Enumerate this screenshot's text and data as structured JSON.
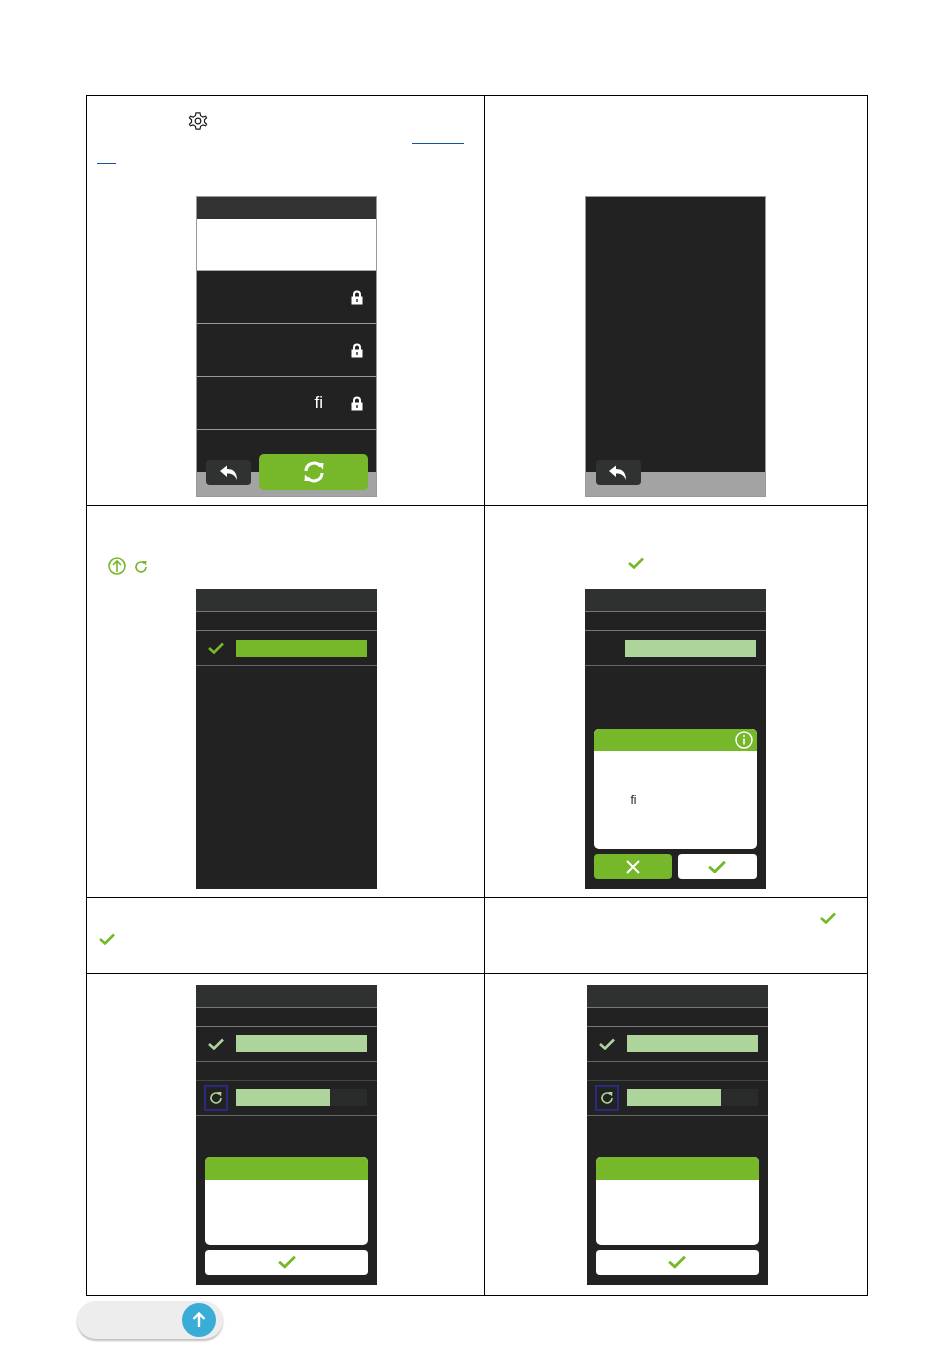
{
  "cells": [
    {
      "kind": "settings",
      "lock_rows": [
        {
          "label": ""
        },
        {
          "label": ""
        },
        {
          "label": "fi"
        }
      ]
    },
    {
      "kind": "blank"
    },
    {
      "kind": "progress",
      "bars": [
        {
          "level": 1,
          "done": true,
          "highlighted": true
        }
      ]
    },
    {
      "kind": "confirm",
      "bars": [
        {
          "level": 1,
          "done": false,
          "highlighted": false
        }
      ],
      "dialog_text": "fi"
    },
    {
      "kind": "note_left"
    },
    {
      "kind": "note_right"
    },
    {
      "kind": "result",
      "bars": [
        {
          "level": 1,
          "done": true,
          "highlighted": false
        },
        {
          "level": 0.72,
          "done": false,
          "highlighted": false
        }
      ]
    },
    {
      "kind": "result",
      "bars": [
        {
          "level": 1,
          "done": true,
          "highlighted": false
        },
        {
          "level": 0.72,
          "done": false,
          "highlighted": false
        }
      ]
    }
  ]
}
